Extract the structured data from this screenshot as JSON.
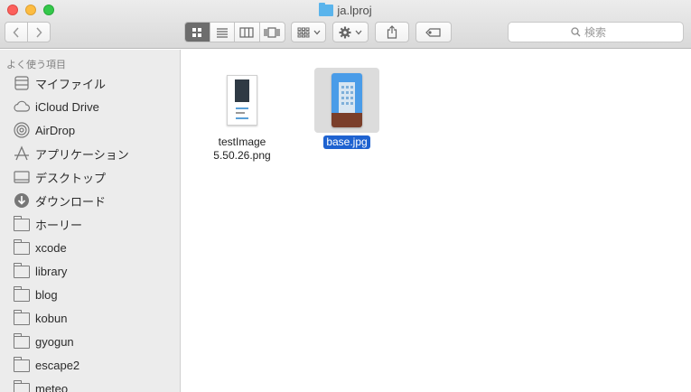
{
  "window": {
    "title": "ja.lproj"
  },
  "toolbar": {
    "search_placeholder": "検索"
  },
  "sidebar": {
    "section_title": "よく使う項目",
    "items": [
      {
        "label": "マイファイル",
        "icon": "all-files-icon"
      },
      {
        "label": "iCloud Drive",
        "icon": "cloud-icon"
      },
      {
        "label": "AirDrop",
        "icon": "airdrop-icon"
      },
      {
        "label": "アプリケーション",
        "icon": "applications-icon"
      },
      {
        "label": "デスクトップ",
        "icon": "desktop-icon"
      },
      {
        "label": "ダウンロード",
        "icon": "download-icon"
      },
      {
        "label": "ホーリー",
        "icon": "folder-icon"
      },
      {
        "label": "xcode",
        "icon": "folder-icon"
      },
      {
        "label": "library",
        "icon": "folder-icon"
      },
      {
        "label": "blog",
        "icon": "folder-icon"
      },
      {
        "label": "kobun",
        "icon": "folder-icon"
      },
      {
        "label": "gyogun",
        "icon": "folder-icon"
      },
      {
        "label": "escape2",
        "icon": "folder-icon"
      },
      {
        "label": "meteo",
        "icon": "folder-icon"
      }
    ]
  },
  "files": [
    {
      "name_line1": "testImage",
      "name_line2": "5.50.26.png",
      "selected": false
    },
    {
      "name_line1": "base.jpg",
      "selected": true
    }
  ],
  "colors": {
    "selection": "#1e62d0",
    "folder_accent": "#5ab4ec"
  }
}
